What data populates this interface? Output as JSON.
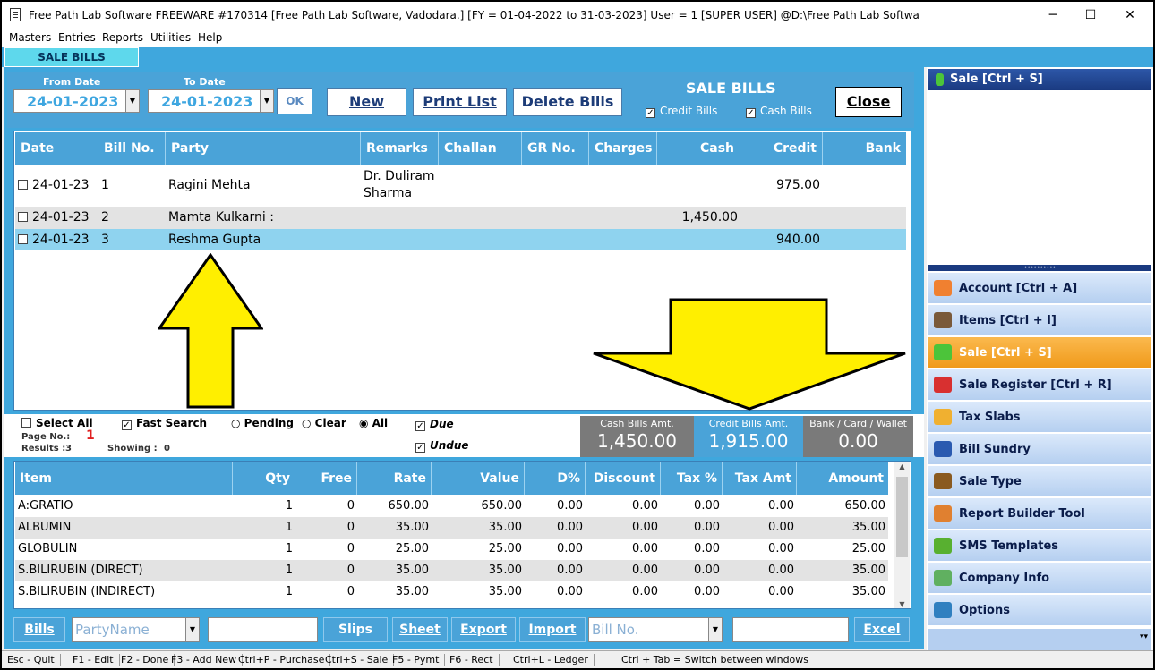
{
  "window": {
    "title": "Free Path Lab Software FREEWARE  #170314  [Free Path Lab Software, Vadodara.] [FY = 01-04-2022 to 31-03-2023] User = 1 [SUPER USER]  @D:\\Free Path Lab Softwa",
    "minimize": "─",
    "maximize": "☐",
    "close": "✕"
  },
  "menu": [
    "Masters",
    "Entries",
    "Reports",
    "Utilities",
    "Help"
  ],
  "tab": "SALE BILLS",
  "filters": {
    "from_label": "From Date",
    "from_value": "24-01-2023",
    "to_label": "To Date",
    "to_value": "24-01-2023",
    "ok": "OK",
    "new": "New",
    "print_list": "Print List",
    "delete_bills": "Delete Bills",
    "section_title": "SALE BILLS",
    "credit_bills": "Credit Bills",
    "cash_bills": "Cash Bills",
    "close": "Close"
  },
  "bills": {
    "columns": [
      "Date",
      "Bill No.",
      "Party",
      "Remarks",
      "Challan",
      "GR No.",
      "Charges",
      "Cash",
      "Credit",
      "Bank"
    ],
    "rows": [
      {
        "date": "24-01-23",
        "bill_no": "1",
        "party": "Ragini Mehta",
        "remarks_1": "Dr. Duliram",
        "remarks_2": "Sharma",
        "cash": "",
        "credit": "975.00"
      },
      {
        "date": "24-01-23",
        "bill_no": "2",
        "party": "Mamta Kulkarni :",
        "remarks_1": "",
        "remarks_2": "",
        "cash": "1,450.00",
        "credit": ""
      },
      {
        "date": "24-01-23",
        "bill_no": "3",
        "party": "Reshma Gupta",
        "remarks_1": "",
        "remarks_2": "",
        "cash": "",
        "credit": "940.00"
      }
    ]
  },
  "summary": {
    "select_all": "Select All",
    "fast_search": "Fast Search",
    "pending": "Pending",
    "clear": "Clear",
    "all": "All",
    "due": "Due",
    "undue": "Undue",
    "page_no_label": "Page No.:",
    "page_no": "1",
    "results_label": "Results :",
    "results": "3",
    "showing_label": "Showing :",
    "showing": "0",
    "cash_label": "Cash Bills Amt.",
    "cash_value": "1,450.00",
    "credit_label": "Credit Bills Amt.",
    "credit_value": "1,915.00",
    "bank_label": "Bank / Card / Wallet",
    "bank_value": "0.00"
  },
  "items": {
    "columns": [
      "Item",
      "Qty",
      "Free",
      "Rate",
      "Value",
      "D%",
      "Discount",
      "Tax %",
      "Tax Amt",
      "Amount"
    ],
    "rows": [
      [
        "A:GRATIO",
        "1",
        "0",
        "650.00",
        "650.00",
        "0.00",
        "0.00",
        "0.00",
        "0.00",
        "650.00"
      ],
      [
        "ALBUMIN",
        "1",
        "0",
        "35.00",
        "35.00",
        "0.00",
        "0.00",
        "0.00",
        "0.00",
        "35.00"
      ],
      [
        "GLOBULIN",
        "1",
        "0",
        "25.00",
        "25.00",
        "0.00",
        "0.00",
        "0.00",
        "0.00",
        "25.00"
      ],
      [
        "S.BILIRUBIN (DIRECT)",
        "1",
        "0",
        "35.00",
        "35.00",
        "0.00",
        "0.00",
        "0.00",
        "0.00",
        "35.00"
      ],
      [
        "S.BILIRUBIN (INDIRECT)",
        "1",
        "0",
        "35.00",
        "35.00",
        "0.00",
        "0.00",
        "0.00",
        "0.00",
        "35.00"
      ]
    ]
  },
  "bottombar": {
    "bills": "Bills",
    "party_placeholder": "PartyName",
    "slips": "Slips",
    "sheet": "Sheet",
    "export": "Export",
    "import": "Import",
    "billno_placeholder": "Bill No.",
    "excel": "Excel"
  },
  "sidepanel": {
    "header": "Sale [Ctrl + S]",
    "items": [
      {
        "label": "Account [Ctrl + A]",
        "icon": "chat-bubble-icon",
        "color": "#f08030"
      },
      {
        "label": "Items [Ctrl + I]",
        "icon": "film-reel-icon",
        "color": "#7a5a3a"
      },
      {
        "label": "Sale [Ctrl + S]",
        "icon": "green-cylinder-icon",
        "color": "#4cc43a"
      },
      {
        "label": "Sale Register [Ctrl + R]",
        "icon": "register-icon",
        "color": "#d83030"
      },
      {
        "label": "Tax Slabs",
        "icon": "magnifier-icon",
        "color": "#f0b030"
      },
      {
        "label": "Bill Sundry",
        "icon": "user-globe-icon",
        "color": "#2a5ab0"
      },
      {
        "label": "Sale Type",
        "icon": "gears-icon",
        "color": "#8a5a20"
      },
      {
        "label": "Report Builder Tool",
        "icon": "house-icon",
        "color": "#e08030"
      },
      {
        "label": "SMS Templates",
        "icon": "pen-icon",
        "color": "#58b030"
      },
      {
        "label": "Company Info",
        "icon": "handshake-icon",
        "color": "#60b060"
      },
      {
        "label": "Options",
        "icon": "globe-icon",
        "color": "#3080c0"
      }
    ]
  },
  "statusbar": [
    "Esc - Quit",
    "F1 - Edit",
    "F2 - Done",
    "F3 - Add New",
    "Ctrl+P - Purchase",
    "Ctrl+S - Sale",
    "F5 - Pymt",
    "F6 - Rect",
    "Ctrl+L - Ledger",
    "Ctrl + Tab = Switch between windows"
  ],
  "colors": {
    "header_blue": "#4aa3d8",
    "selected_row": "#8fd3ef",
    "active_nav": "#f5a623",
    "arrow": "#ffef00"
  }
}
